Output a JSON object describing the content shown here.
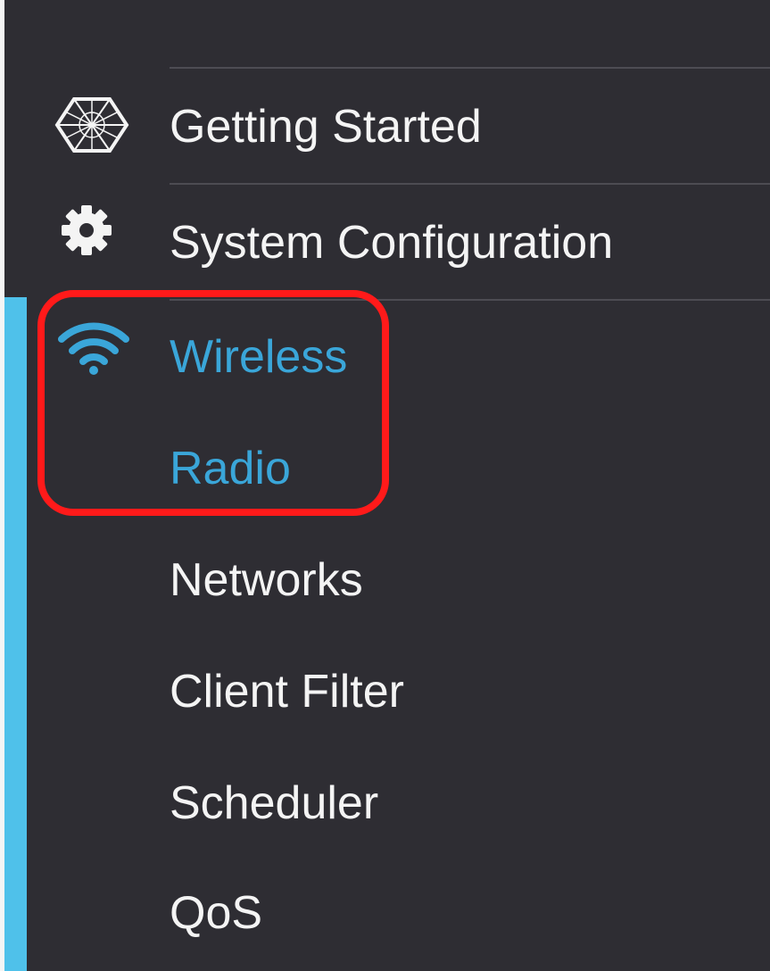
{
  "nav": {
    "items": [
      {
        "label": "Getting Started",
        "icon": "network-globe-icon",
        "active": false
      },
      {
        "label": "System Configuration",
        "icon": "gear-icon",
        "active": false
      },
      {
        "label": "Wireless",
        "icon": "wifi-icon",
        "active": true
      },
      {
        "label": "Radio",
        "active": true
      },
      {
        "label": "Networks",
        "active": false
      },
      {
        "label": "Client Filter",
        "active": false
      },
      {
        "label": "Scheduler",
        "active": false
      },
      {
        "label": "QoS",
        "active": false
      }
    ]
  },
  "colors": {
    "background": "#2e2d33",
    "text": "#f4f4f4",
    "active_text": "#3aa6d9",
    "active_bar": "#4fc1ea",
    "highlight": "#ff1a1a",
    "divider": "#4d4c53"
  }
}
